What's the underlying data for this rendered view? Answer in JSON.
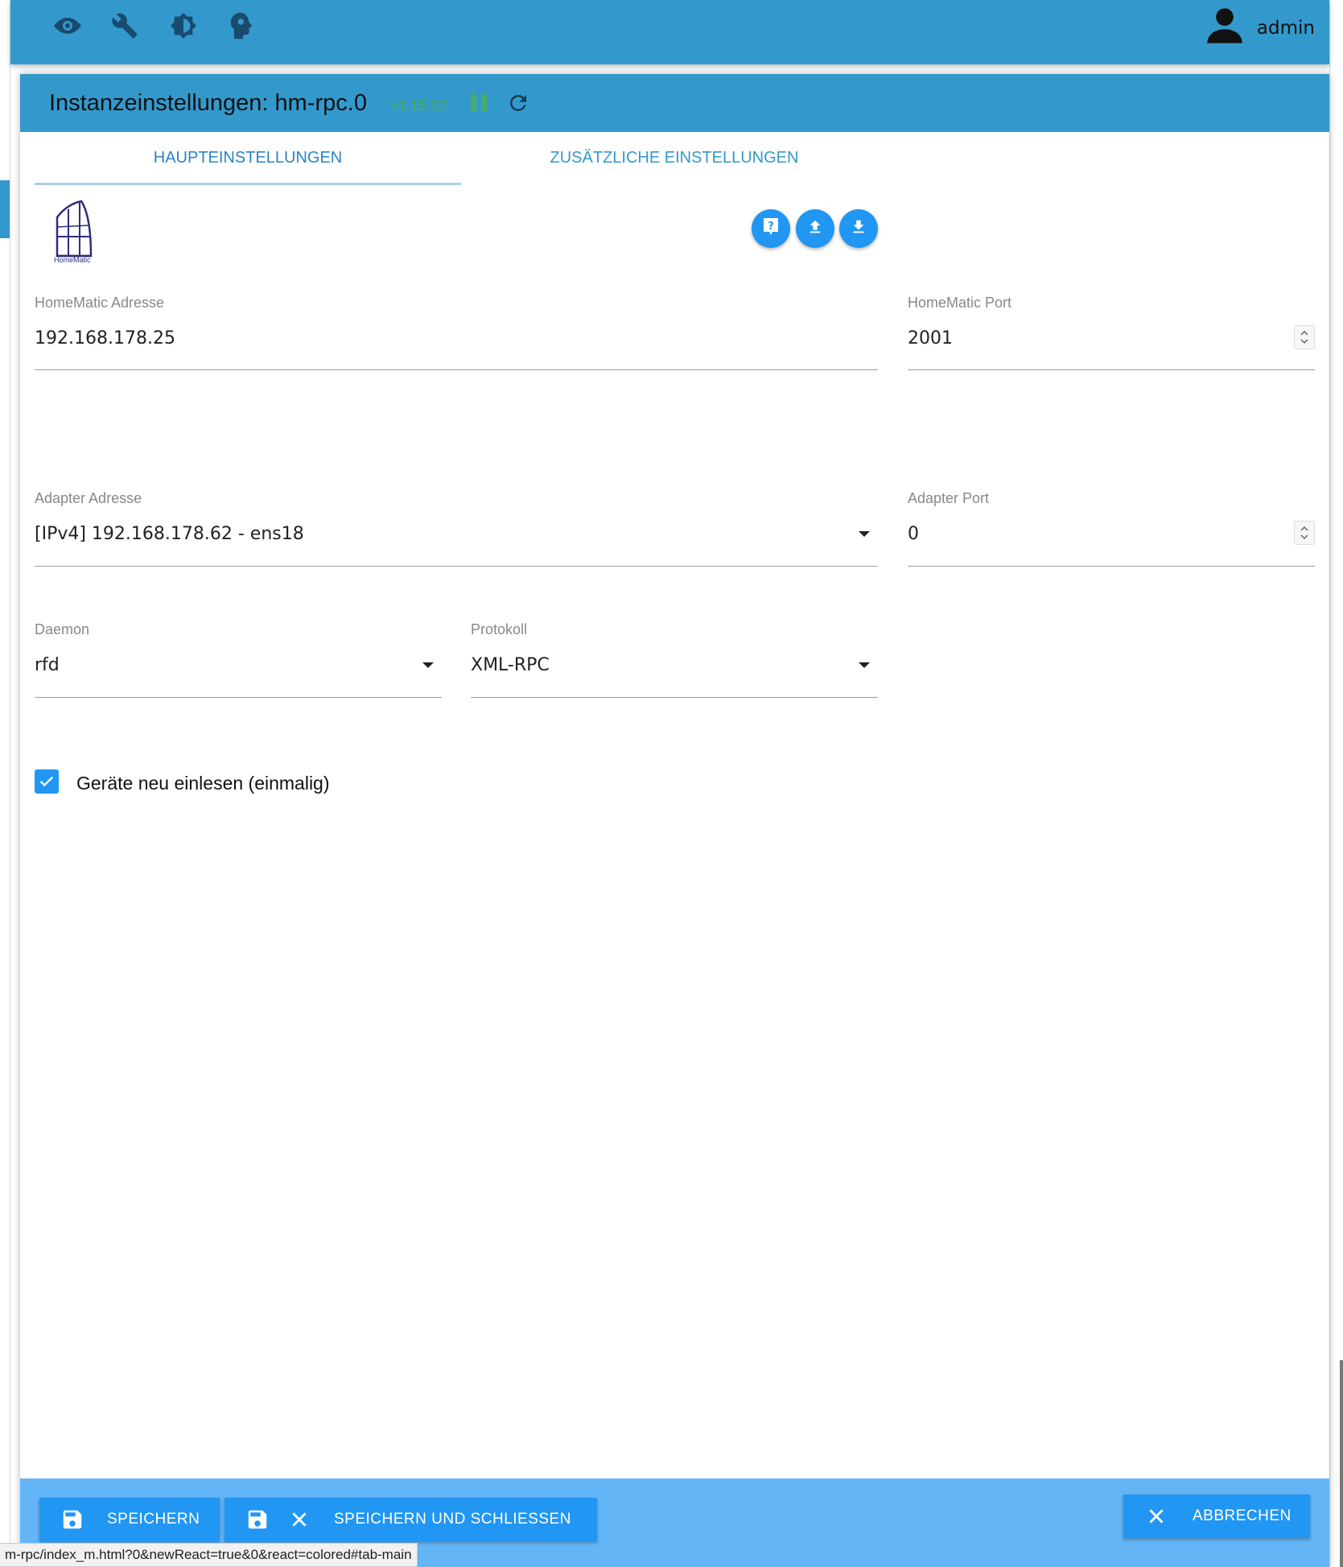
{
  "appbar": {
    "tools": [
      "eye-icon",
      "wrench-icon",
      "brightness-icon",
      "brain-icon"
    ],
    "user_name": "admin"
  },
  "dialog": {
    "title": "Instanzeinstellungen: hm-rpc.0",
    "version": "v1.15.12",
    "version_color": "#4caf50",
    "accent_color": "#3399cc"
  },
  "tabs": [
    {
      "label": "HAUPTEINSTELLUNGEN",
      "active": true
    },
    {
      "label": "ZUSÄTZLICHE EINSTELLUNGEN",
      "active": false
    }
  ],
  "logo_text": "HomeMatic",
  "action_icons": [
    "help-icon",
    "upload-icon",
    "download-icon"
  ],
  "fields": {
    "homematic_address": {
      "label": "HomeMatic Adresse",
      "value": "192.168.178.25"
    },
    "homematic_port": {
      "label": "HomeMatic Port",
      "value": "2001"
    },
    "adapter_address": {
      "label": "Adapter Adresse",
      "value": "[IPv4] 192.168.178.62 - ens18"
    },
    "adapter_port": {
      "label": "Adapter Port",
      "value": "0"
    },
    "daemon": {
      "label": "Daemon",
      "value": "rfd"
    },
    "protocol": {
      "label": "Protokoll",
      "value": "XML-RPC"
    }
  },
  "checkbox": {
    "label": "Geräte neu einlesen (einmalig)",
    "checked": true
  },
  "footer": {
    "save": "SPEICHERN",
    "save_close": "SPEICHERN UND SCHLIESSEN",
    "cancel": "ABBRECHEN"
  },
  "status_url": "m-rpc/index_m.html?0&newReact=true&0&react=colored#tab-main"
}
